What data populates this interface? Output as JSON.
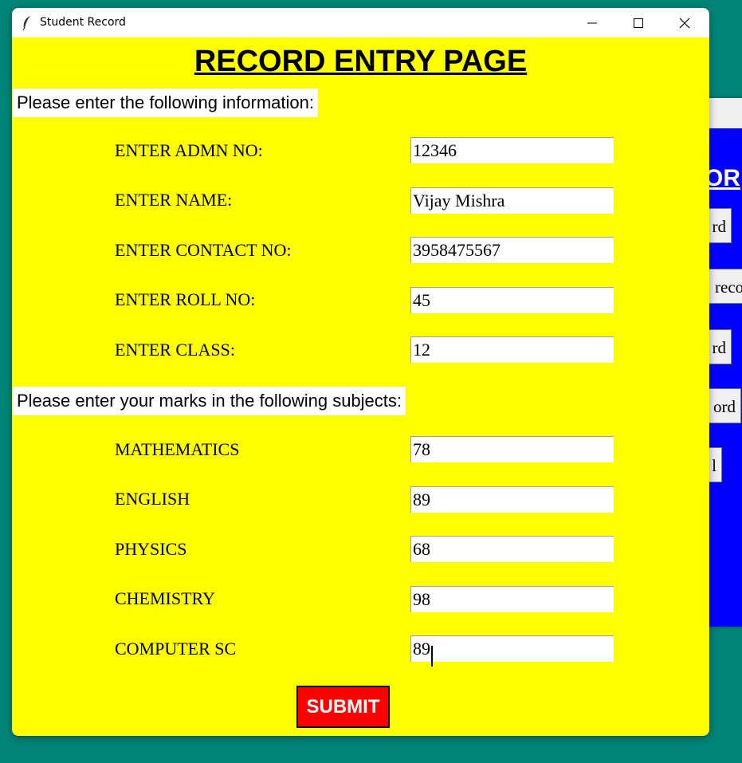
{
  "window": {
    "title": "Student Record",
    "icon": "feather-icon",
    "controls": [
      "minimize-icon",
      "maximize-icon",
      "close-icon"
    ]
  },
  "page": {
    "heading": "RECORD ENTRY PAGE",
    "info_prompt": "Please enter the following information:",
    "marks_prompt": "Please enter your marks in the following subjects:",
    "submit_label": "SUBMIT"
  },
  "info_fields": [
    {
      "label": "ENTER ADMN NO:",
      "value": "12346"
    },
    {
      "label": "ENTER NAME:",
      "value": "Vijay Mishra"
    },
    {
      "label": "ENTER CONTACT NO:",
      "value": "3958475567"
    },
    {
      "label": "ENTER ROLL NO:",
      "value": "45"
    },
    {
      "label": "ENTER CLASS:",
      "value": "12"
    }
  ],
  "marks_fields": [
    {
      "label": "MATHEMATICS",
      "value": "78"
    },
    {
      "label": "ENGLISH",
      "value": "89"
    },
    {
      "label": "PHYSICS",
      "value": "68"
    },
    {
      "label": "CHEMISTRY",
      "value": "98"
    },
    {
      "label": "COMPUTER SC",
      "value": "89"
    }
  ],
  "background_window": {
    "title_fragment": "OR",
    "buttons": [
      "rd",
      "reco",
      "rd",
      "ord",
      "l"
    ]
  },
  "colors": {
    "desktop": "#008577",
    "form_background": "#ffff00",
    "submit_background": "#ff0000",
    "background_window": "#0000ff"
  }
}
